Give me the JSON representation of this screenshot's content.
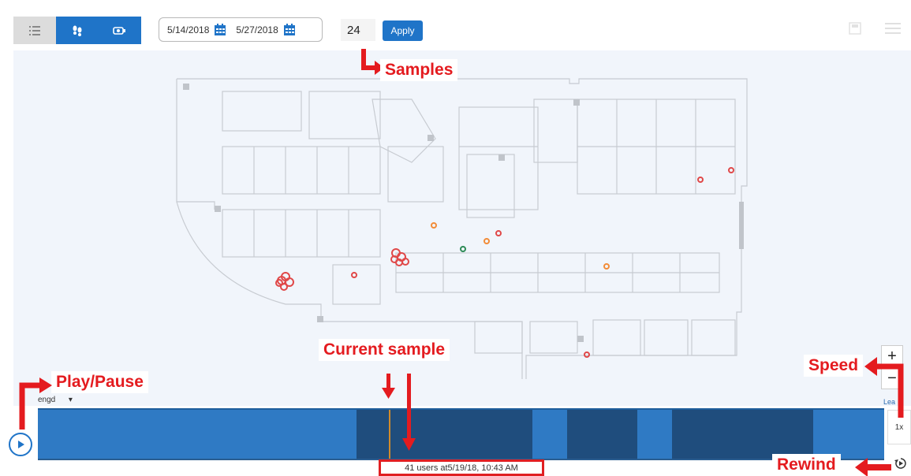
{
  "toolbar": {
    "start_date": "5/14/2018",
    "end_date": "5/27/2018",
    "samples_value": "24",
    "apply_label": "Apply"
  },
  "map": {
    "zoom_in": "+",
    "zoom_out": "−",
    "legend_fragment": "Lea",
    "left_fragment": "engd      ▾"
  },
  "timeline": {
    "status": "41 users at5/19/18, 10:43 AM",
    "speed": "1x"
  },
  "annotations": {
    "samples": "Samples",
    "play_pause": "Play/Pause",
    "current_sample": "Current sample",
    "speed": "Speed",
    "rewind": "Rewind"
  },
  "colors": {
    "accent": "#1f74c8",
    "annotation": "#e41b1f",
    "timeline_bg": "#2f7ac4",
    "timeline_dark": "#1f4d7d",
    "marker": "#d18b2b"
  }
}
